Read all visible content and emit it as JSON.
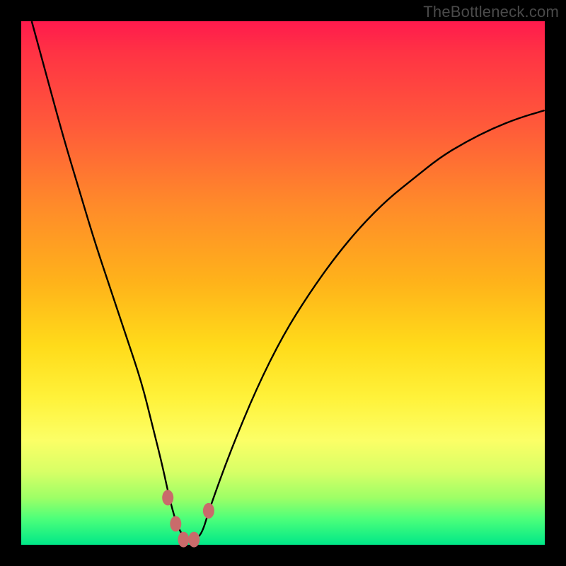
{
  "watermark": "TheBottleneck.com",
  "chart_data": {
    "type": "line",
    "title": "",
    "xlabel": "",
    "ylabel": "",
    "xlim": [
      0,
      100
    ],
    "ylim": [
      0,
      100
    ],
    "series": [
      {
        "name": "bottleneck-curve",
        "x": [
          2,
          5,
          8,
          11,
          14,
          17,
          20,
          23,
          25,
          27,
          28.5,
          30,
          31.5,
          33,
          34.5,
          36,
          40,
          45,
          50,
          55,
          60,
          65,
          70,
          75,
          80,
          85,
          90,
          95,
          100
        ],
        "values": [
          100,
          89,
          78,
          68,
          58,
          49,
          40,
          31,
          23,
          15,
          8,
          3,
          1,
          1,
          2,
          7,
          18,
          30,
          40,
          48,
          55,
          61,
          66,
          70,
          74,
          77,
          79.5,
          81.5,
          83
        ]
      }
    ],
    "markers": [
      {
        "name": "left-dot-1",
        "x": 28,
        "y": 9
      },
      {
        "name": "left-dot-2",
        "x": 29.5,
        "y": 4
      },
      {
        "name": "floor-dot-1",
        "x": 31,
        "y": 1
      },
      {
        "name": "floor-dot-2",
        "x": 33,
        "y": 1
      },
      {
        "name": "right-dot",
        "x": 35.8,
        "y": 6.5
      }
    ],
    "colors": {
      "curve": "#000000",
      "markers": "#c96b6b",
      "gradient_top": "#ff1a4d",
      "gradient_mid": "#ffdb1a",
      "gradient_bottom": "#00e888"
    }
  }
}
